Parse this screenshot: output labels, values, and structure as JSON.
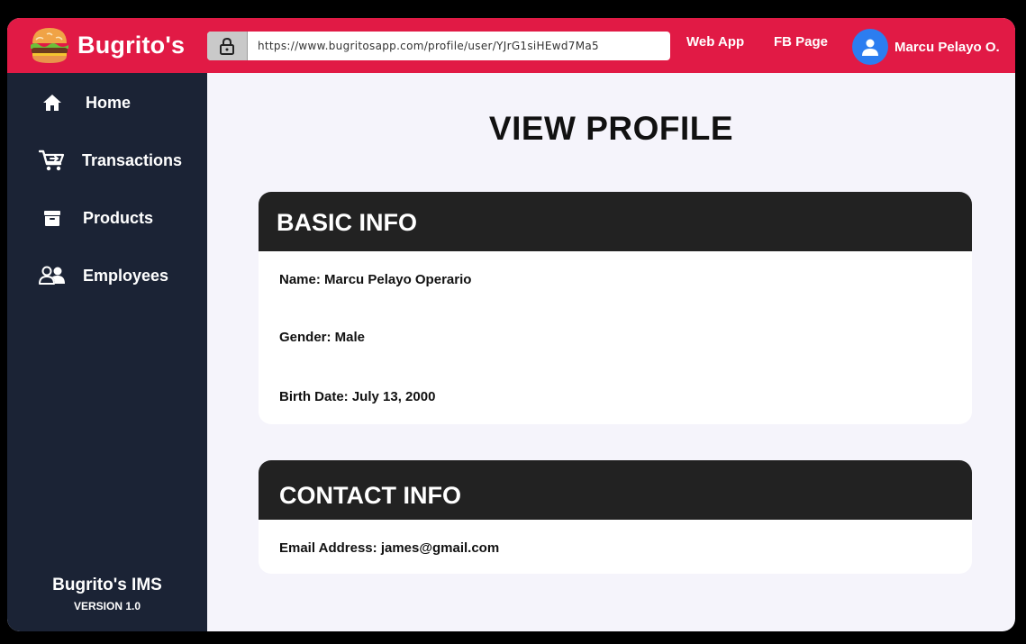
{
  "header": {
    "brand_name": "Bugrito's",
    "url": "https://www.bugritosapp.com/profile/user/YJrG1siHEwd7Ma5",
    "links": {
      "web_app": "Web App",
      "fb_page": "FB Page"
    },
    "user_name": "Marcu Pelayo O."
  },
  "sidebar": {
    "items": [
      {
        "label": "Home",
        "icon": "home-icon"
      },
      {
        "label": "Transactions",
        "icon": "cart-icon"
      },
      {
        "label": "Products",
        "icon": "archive-box-icon"
      },
      {
        "label": "Employees",
        "icon": "users-icon"
      }
    ],
    "footer_title": "Bugrito's IMS",
    "footer_version": "VERSION 1.0"
  },
  "main": {
    "page_title": "VIEW PROFILE",
    "basic_info": {
      "heading": "BASIC INFO",
      "name": "Name: Marcu Pelayo Operario",
      "gender": "Gender: Male",
      "birth_date": "Birth Date: July 13, 2000"
    },
    "contact_info": {
      "heading": "CONTACT INFO",
      "email": "Email Address: james@gmail.com"
    }
  },
  "colors": {
    "header_bg": "#e11a45",
    "sidebar_bg": "#1b2335",
    "card_header_bg": "#222222",
    "content_bg": "#f5f4fb",
    "avatar_bg": "#2c7df0"
  }
}
